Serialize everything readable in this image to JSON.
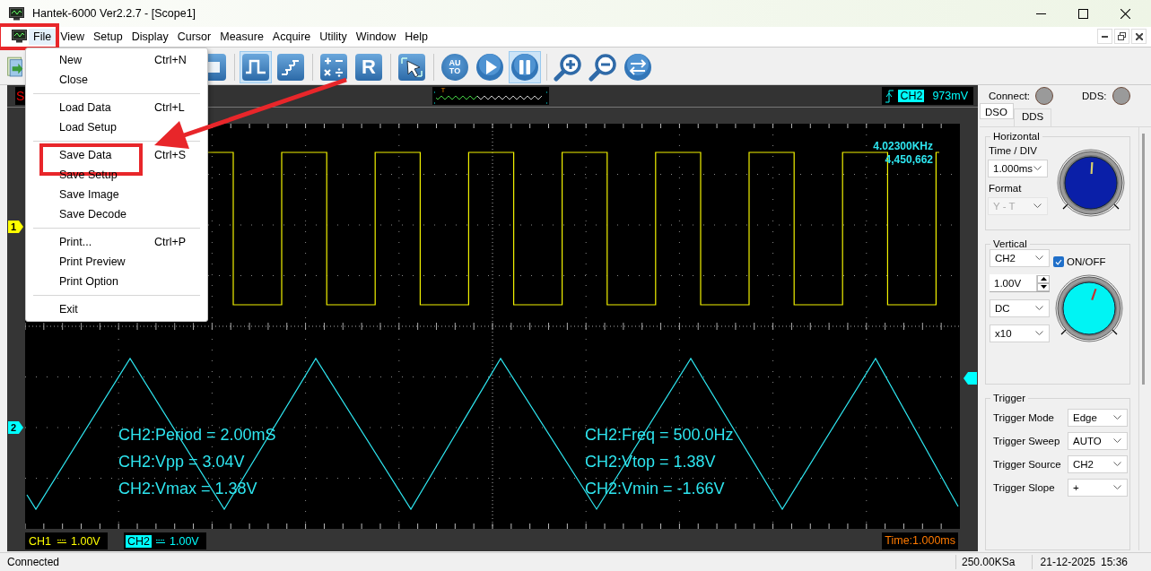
{
  "window": {
    "title": "Hantek-6000 Ver2.2.7 - [Scope1]"
  },
  "menu_bar": [
    {
      "label": "File",
      "selected": true,
      "annotated": true
    },
    {
      "label": "View",
      "selected": false,
      "annotated": false
    },
    {
      "label": "Setup",
      "selected": false,
      "annotated": false
    },
    {
      "label": "Display",
      "selected": false,
      "annotated": false
    },
    {
      "label": "Cursor",
      "selected": false,
      "annotated": false
    },
    {
      "label": "Measure",
      "selected": false,
      "annotated": false
    },
    {
      "label": "Acquire",
      "selected": false,
      "annotated": false
    },
    {
      "label": "Utility",
      "selected": false,
      "annotated": false
    },
    {
      "label": "Window",
      "selected": false,
      "annotated": false
    },
    {
      "label": "Help",
      "selected": false,
      "annotated": false
    }
  ],
  "toolbar": [
    {
      "kind": "open",
      "pressed": false
    },
    {
      "kind": "blank",
      "pressed": false
    },
    {
      "kind": "separator"
    },
    {
      "kind": "square",
      "pressed": true
    },
    {
      "kind": "step",
      "pressed": false
    },
    {
      "kind": "separator"
    },
    {
      "kind": "math",
      "pressed": false
    },
    {
      "kind": "letter",
      "label": "R",
      "pressed": false
    },
    {
      "kind": "separator"
    },
    {
      "kind": "cursor",
      "pressed": false
    },
    {
      "kind": "separator"
    },
    {
      "kind": "auto",
      "label_lines": [
        "AU",
        "TO"
      ],
      "pressed": false
    },
    {
      "kind": "play",
      "pressed": false
    },
    {
      "kind": "pause",
      "pressed": true
    },
    {
      "kind": "separator"
    },
    {
      "kind": "zoom_in",
      "pressed": false
    },
    {
      "kind": "zoom_out",
      "pressed": false
    },
    {
      "kind": "swap",
      "pressed": false
    }
  ],
  "file_menu": {
    "annotation_arrow": true,
    "groups": [
      [
        {
          "label": "New",
          "shortcut": "Ctrl+N",
          "annotated": false
        },
        {
          "label": "Close",
          "annotated": false
        }
      ],
      [
        {
          "label": "Load Data",
          "shortcut": "Ctrl+L",
          "annotated": false
        },
        {
          "label": "Load Setup",
          "annotated": false
        }
      ],
      [
        {
          "label": "Save Data",
          "shortcut": "Ctrl+S",
          "annotated": true
        },
        {
          "label": "Save Setup",
          "annotated": false
        },
        {
          "label": "Save Image",
          "annotated": false
        },
        {
          "label": "Save Decode",
          "annotated": false
        }
      ],
      [
        {
          "label": "Print...",
          "shortcut": "Ctrl+P",
          "annotated": false
        },
        {
          "label": "Print Preview",
          "annotated": false
        },
        {
          "label": "Print Option",
          "annotated": false
        }
      ],
      [
        {
          "label": "Exit",
          "annotated": false
        }
      ]
    ]
  },
  "scope": {
    "status": "S",
    "trigger_preview": {
      "marker": "T"
    },
    "trigger_readout": {
      "source": "CH2",
      "level": "973mV"
    },
    "channel_markers": [
      {
        "label": "1",
        "color": "#ffff00"
      },
      {
        "label": "2",
        "color": "#00ffff"
      }
    ],
    "counter": {
      "frequency": "4.02300KHz",
      "count": "4,450,662"
    },
    "measurements": {
      "left": [
        "CH2:Period = 2.00mS",
        "CH2:Vpp = 3.04V",
        "CH2:Vmax = 1.38V"
      ],
      "right": [
        "CH2:Freq = 500.0Hz",
        "CH2:Vtop = 1.38V",
        "CH2:Vmin = -1.66V"
      ]
    },
    "channels": [
      {
        "name": "CH1",
        "volts": "1.00V",
        "color": "#ffff00",
        "selected": false
      },
      {
        "name": "CH2",
        "volts": "1.00V",
        "color": "#00ffff",
        "selected": true
      }
    ],
    "time": "Time:1.000ms"
  },
  "side_panel": {
    "indicators": [
      {
        "label": "Connect:",
        "on": false
      },
      {
        "label": "DDS:",
        "on": false
      }
    ],
    "tabs": [
      {
        "label": "DSO",
        "selected": true
      },
      {
        "label": "DDS",
        "selected": false
      }
    ],
    "horizontal": {
      "title": "Horizontal",
      "time_div_label": "Time / DIV",
      "time_div": "1.000ms",
      "format_label": "Format",
      "format": "Y - T",
      "format_disabled": true
    },
    "vertical": {
      "title": "Vertical",
      "channel": "CH2",
      "onoff_label": "ON/OFF",
      "onoff_checked": true,
      "volts": "1.00V",
      "coupling": "DC",
      "probe": "x10"
    },
    "trigger": {
      "title": "Trigger",
      "rows": [
        {
          "label": "Trigger Mode",
          "value": "Edge"
        },
        {
          "label": "Trigger Sweep",
          "value": "AUTO"
        },
        {
          "label": "Trigger Source",
          "value": "CH2"
        },
        {
          "label": "Trigger Slope",
          "value": "+"
        }
      ]
    }
  },
  "status_bar": {
    "message": "Connected",
    "sample_rate": "250.00KSa",
    "date": "21-12-2025",
    "time": "15:36"
  }
}
